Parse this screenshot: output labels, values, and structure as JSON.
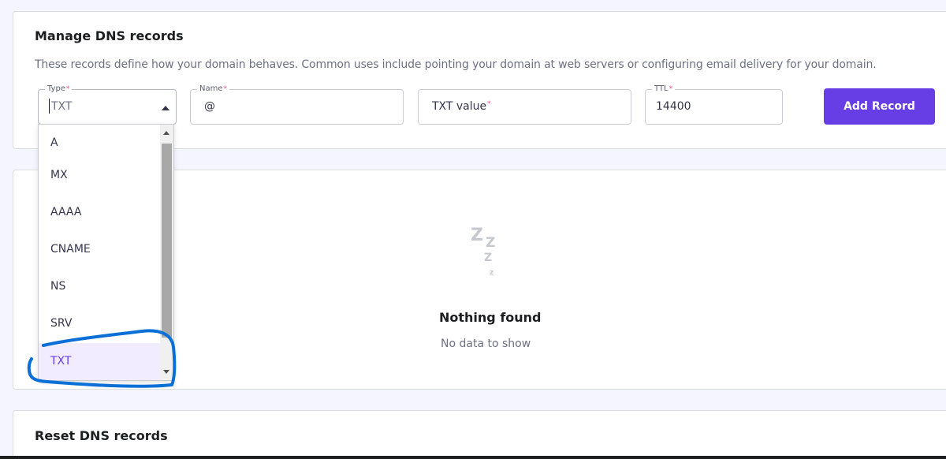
{
  "manage": {
    "title": "Manage DNS records",
    "description": "These records define how your domain behaves. Common uses include pointing your domain at web servers or configuring email delivery for your domain.",
    "fields": {
      "type": {
        "label": "Type",
        "value": "TXT"
      },
      "name": {
        "label": "Name",
        "value": "@"
      },
      "txt_value": {
        "placeholder": "TXT value"
      },
      "ttl": {
        "label": "TTL",
        "value": "14400"
      }
    },
    "add_button": "Add Record",
    "type_options": [
      "A",
      "MX",
      "AAAA",
      "CNAME",
      "NS",
      "SRV",
      "TXT"
    ],
    "selected_option": "TXT"
  },
  "records": {
    "empty_icon": "sleeping-zzz-icon",
    "empty_title": "Nothing found",
    "empty_subtitle": "No data to show"
  },
  "reset": {
    "title": "Reset DNS records"
  },
  "colors": {
    "accent": "#673de6",
    "required": "#fc5185",
    "annotation": "#0a6fd6"
  }
}
